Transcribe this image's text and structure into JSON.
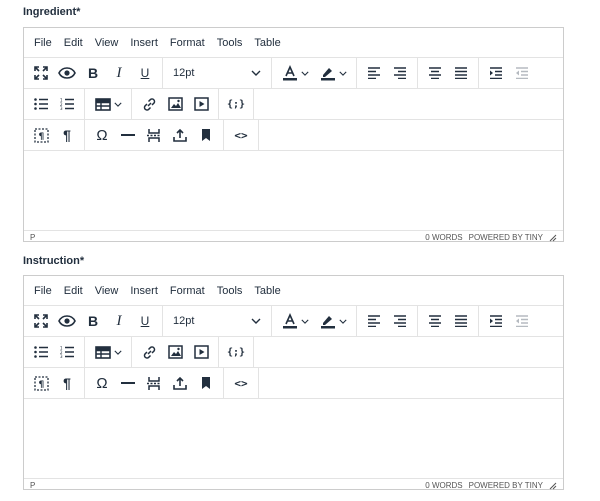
{
  "editors": [
    {
      "label": "Ingredient*",
      "menu": [
        "File",
        "Edit",
        "View",
        "Insert",
        "Format",
        "Tools",
        "Table"
      ],
      "font_size": "12pt",
      "status_path": "P",
      "word_count": "0 WORDS",
      "powered_by": "POWERED BY TINY"
    },
    {
      "label": "Instruction*",
      "menu": [
        "File",
        "Edit",
        "View",
        "Insert",
        "Format",
        "Tools",
        "Table"
      ],
      "font_size": "12pt",
      "status_path": "P",
      "word_count": "0 WORDS",
      "powered_by": "POWERED BY TINY"
    }
  ],
  "colors": {
    "text": "#222f3e",
    "border": "#cccccc",
    "divider": "#e3e3e3",
    "disabled": "#b5bac0"
  },
  "icons": {
    "bold": "B",
    "italic": "I",
    "underline": "U",
    "paragraph": "¶",
    "omega": "Ω",
    "code": "<>",
    "codesample": "{;}"
  }
}
